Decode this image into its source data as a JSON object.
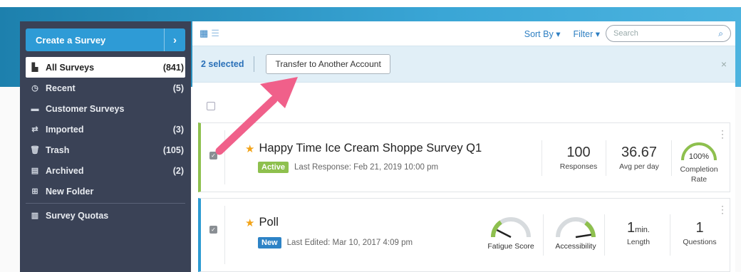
{
  "sidebar": {
    "create_label": "Create a Survey",
    "items": [
      {
        "icon": "file-icon",
        "glyph": "▙",
        "label": "All Surveys",
        "count": "(841)",
        "active": true
      },
      {
        "icon": "clock-icon",
        "glyph": "◷",
        "label": "Recent",
        "count": "(5)"
      },
      {
        "icon": "folder-icon",
        "glyph": "▬",
        "label": "Customer Surveys",
        "count": ""
      },
      {
        "icon": "exchange-icon",
        "glyph": "⇄",
        "label": "Imported",
        "count": "(3)"
      },
      {
        "icon": "trash-icon",
        "glyph": "🗑",
        "label": "Trash",
        "count": "(105)"
      },
      {
        "icon": "archive-icon",
        "glyph": "▤",
        "label": "Archived",
        "count": "(2)"
      },
      {
        "icon": "plus-square-icon",
        "glyph": "⊞",
        "label": "New Folder",
        "count": ""
      },
      {
        "icon": "bar-chart-icon",
        "glyph": "▥",
        "label": "Survey Quotas",
        "count": ""
      }
    ]
  },
  "toolbar": {
    "sort_label": "Sort By ▾",
    "filter_label": "Filter ▾",
    "search_placeholder": "Search"
  },
  "selection": {
    "count_label": "2 selected",
    "transfer_label": "Transfer to Another Account",
    "close_glyph": "×"
  },
  "surveys": [
    {
      "title": "Happy Time Ice Cream Shoppe Survey Q1",
      "badge": "Active",
      "meta": "Last Response: Feb 21, 2019 10:00 pm",
      "stats": [
        {
          "value": "100",
          "label": "Responses"
        },
        {
          "value": "36.67",
          "label": "Avg per day"
        }
      ],
      "completion": {
        "value": "100%",
        "label1": "Completion",
        "label2": "Rate",
        "fraction": 1.0
      }
    },
    {
      "title": "Poll",
      "badge": "New",
      "meta": "Last Edited: Mar 10, 2017 4:09 pm",
      "gauges": [
        {
          "label": "Fatigue Score",
          "level": 0.15
        },
        {
          "label": "Accessibility",
          "level": 0.95
        }
      ],
      "stats": [
        {
          "value": "1",
          "unit": "min.",
          "label": "Length"
        },
        {
          "value": "1",
          "label": "Questions"
        }
      ]
    }
  ],
  "colors": {
    "accent": "#2e9bd6",
    "active_green": "#8ec04e",
    "new_blue": "#2d83c6",
    "annotation_arrow": "#f0608a"
  }
}
